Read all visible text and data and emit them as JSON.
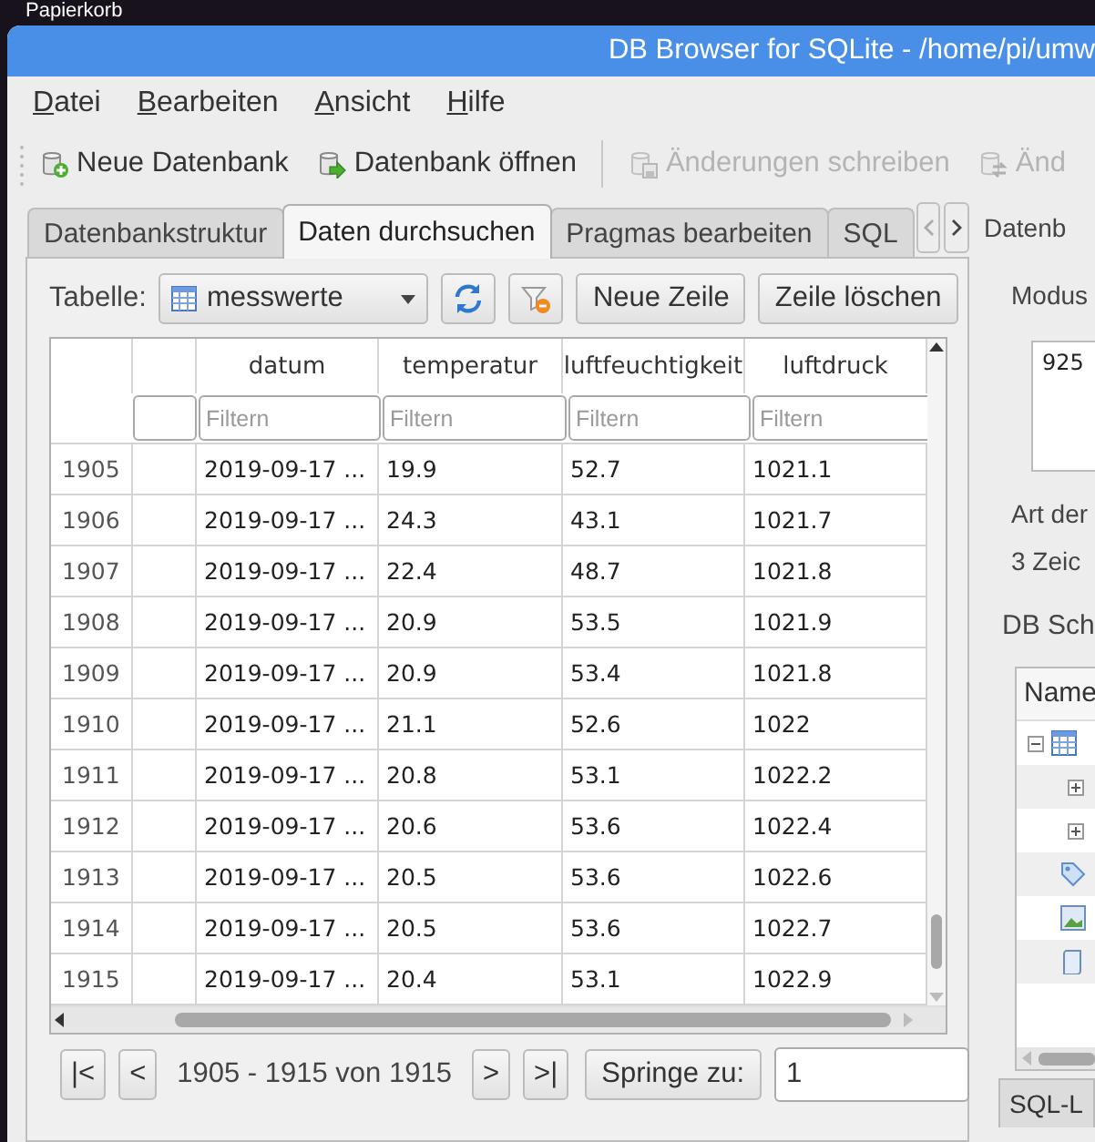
{
  "desktop": {
    "label": "Papierkorb"
  },
  "window": {
    "title": "DB Browser for SQLite - /home/pi/umw"
  },
  "menu": [
    {
      "label": "Datei"
    },
    {
      "label": "Bearbeiten"
    },
    {
      "label": "Ansicht"
    },
    {
      "label": "Hilfe"
    }
  ],
  "toolbar": [
    {
      "kind": "button",
      "label": "Neue Datenbank",
      "disabled": false
    },
    {
      "kind": "button",
      "label": "Datenbank öffnen",
      "disabled": false
    },
    {
      "kind": "separator"
    },
    {
      "kind": "button",
      "label": "Änderungen schreiben",
      "disabled": true
    },
    {
      "kind": "button",
      "label": "Änd",
      "disabled": true
    }
  ],
  "tabs": [
    {
      "label": "Datenbankstruktur",
      "selected": false
    },
    {
      "label": "Daten durchsuchen",
      "selected": true
    },
    {
      "label": "Pragmas bearbeiten",
      "selected": false
    },
    {
      "label": "SQL",
      "selected": false
    }
  ],
  "browse": {
    "table_label": "Tabelle:",
    "table_combo": {
      "value": "messwerte"
    },
    "buttons": [
      {
        "label": "Neue Zeile"
      },
      {
        "label": "Zeile löschen"
      }
    ]
  },
  "grid": {
    "columns": [
      {
        "label": "datum",
        "filter_placeholder": "Filtern"
      },
      {
        "label": "temperatur",
        "filter_placeholder": "Filtern"
      },
      {
        "label": "luftfeuchtigkeit",
        "filter_placeholder": "Filtern"
      },
      {
        "label": "luftdruck",
        "filter_placeholder": "Filtern"
      }
    ],
    "rows": [
      {
        "header": "1905",
        "cells": [
          "2019-09-17 ...",
          "19.9",
          "52.7",
          "1021.1"
        ]
      },
      {
        "header": "1906",
        "cells": [
          "2019-09-17 ...",
          "24.3",
          "43.1",
          "1021.7"
        ]
      },
      {
        "header": "1907",
        "cells": [
          "2019-09-17 ...",
          "22.4",
          "48.7",
          "1021.8"
        ]
      },
      {
        "header": "1908",
        "cells": [
          "2019-09-17 ...",
          "20.9",
          "53.5",
          "1021.9"
        ]
      },
      {
        "header": "1909",
        "cells": [
          "2019-09-17 ...",
          "20.9",
          "53.4",
          "1021.8"
        ]
      },
      {
        "header": "1910",
        "cells": [
          "2019-09-17 ...",
          "21.1",
          "52.6",
          "1022"
        ]
      },
      {
        "header": "1911",
        "cells": [
          "2019-09-17 ...",
          "20.8",
          "53.1",
          "1022.2"
        ]
      },
      {
        "header": "1912",
        "cells": [
          "2019-09-17 ...",
          "20.6",
          "53.6",
          "1022.4"
        ]
      },
      {
        "header": "1913",
        "cells": [
          "2019-09-17 ...",
          "20.5",
          "53.6",
          "1022.6"
        ]
      },
      {
        "header": "1914",
        "cells": [
          "2019-09-17 ...",
          "20.5",
          "53.6",
          "1022.7"
        ]
      },
      {
        "header": "1915",
        "cells": [
          "2019-09-17 ...",
          "20.4",
          "53.1",
          "1022.9"
        ]
      }
    ]
  },
  "nav": {
    "first": "|<",
    "prev": "<",
    "range": "1905 - 1915 von 1915",
    "next": ">",
    "last": ">|",
    "goto_label": "Springe zu:",
    "goto_value": "1"
  },
  "dock": {
    "title": "Datenb",
    "mode_label": "Modus",
    "editor_value": "925",
    "type_label": "Art der",
    "size_label": "3 Zeic",
    "schema_title": "DB Sch",
    "schema_header": "Name",
    "schema_items": [
      {
        "kind": "table",
        "expanded": true,
        "children": [
          {
            "expanded": false
          },
          {
            "expanded": false
          }
        ]
      },
      {
        "kind": "index"
      },
      {
        "kind": "view"
      },
      {
        "kind": "trigger"
      }
    ],
    "bottom_tab": "SQL-L"
  }
}
